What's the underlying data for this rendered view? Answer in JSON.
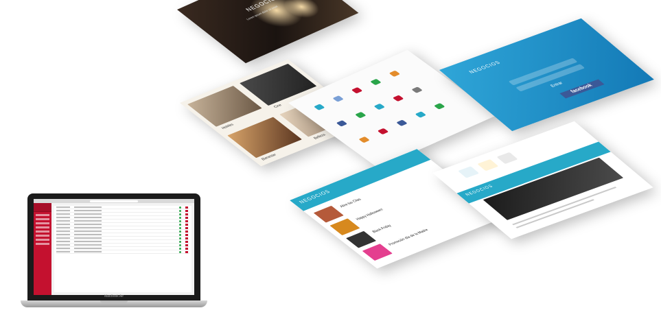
{
  "laptop": {
    "brand": "MacBook Air"
  },
  "screens": {
    "hero": {
      "title": "NEGOCIOS",
      "subtitle": "Lorem ipsum dolor sit amet"
    },
    "categories": {
      "items": [
        "Hoteles",
        "Cine",
        "Bienestar",
        "Belleza"
      ]
    },
    "login": {
      "title": "NEGOCIOS",
      "button": "Entrar",
      "social": "facebook"
    },
    "news": {
      "header": "NEGOCIOS",
      "items": [
        "Abre tus Citas",
        "Happy Halloween!",
        "Black Friday",
        "Promoción día de la Madre"
      ]
    },
    "detail": {
      "header": "NEGOCIOS"
    }
  },
  "colors": {
    "accent_red": "#c4112f",
    "accent_blue": "#27a9c8",
    "facebook": "#3b5998"
  }
}
